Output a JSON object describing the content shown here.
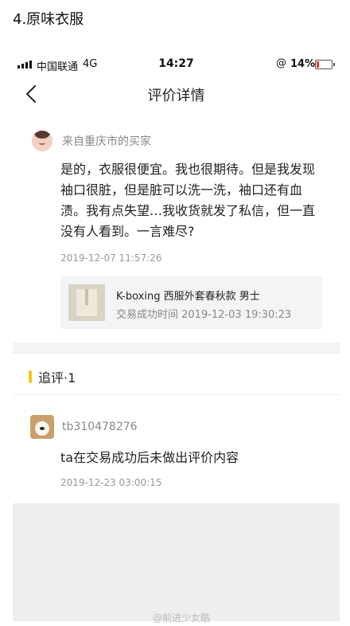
{
  "caption": "4.原味衣服",
  "status": {
    "carrier": "中国联通",
    "network": "4G",
    "time": "14:27",
    "lock_icon": "@",
    "battery_pct": "14%",
    "battery_level": 0.14,
    "battery_color": "#e53935"
  },
  "nav": {
    "title": "评价详情",
    "back_icon": "chevron-left-icon"
  },
  "review": {
    "buyer_label": "来自重庆市的买家",
    "text": "是的，衣服很便宜。我也很期待。但是我发现袖口很脏，但是脏可以洗一洗，袖口还有血渍。我有点失望…我收货就发了私信，但一直没有人看到。一言难尽?",
    "time": "2019-12-07 11:57:26"
  },
  "product": {
    "title": "K-boxing 西服外套春秋款 男士",
    "subtitle": "交易成功时间 2019-12-03 19:30:23"
  },
  "follow_up": {
    "heading": "追评·1",
    "accent": "#f5c518",
    "user_id": "tb310478276",
    "text": "ta在交易成功后未做出评价内容",
    "time": "2019-12-23 03:00:15"
  },
  "watermark": "@前进少女酷"
}
